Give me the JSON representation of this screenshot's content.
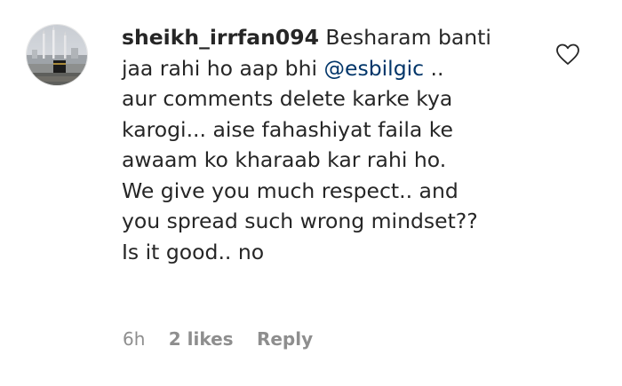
{
  "comment": {
    "username": "sheikh_irrfan094",
    "lines": [
      "Besharam banti",
      "jaa rahi ho aap bhi",
      "..",
      "aur comments delete karke kya",
      "karogi... aise fahashiyat faila ke",
      "awaam ko kharaab kar rahi ho.",
      "We give you much respect.. and",
      "you spread such wrong mindset??",
      "Is it good.. no"
    ],
    "mention": "@esbilgic",
    "time": "6h",
    "likes": "2 likes",
    "reply_label": "Reply",
    "like_icon": "heart-outline-icon",
    "avatar_icon": "mosque-photo-avatar"
  },
  "colors": {
    "text": "#262626",
    "mention": "#003569",
    "meta": "#8e8e8e"
  }
}
